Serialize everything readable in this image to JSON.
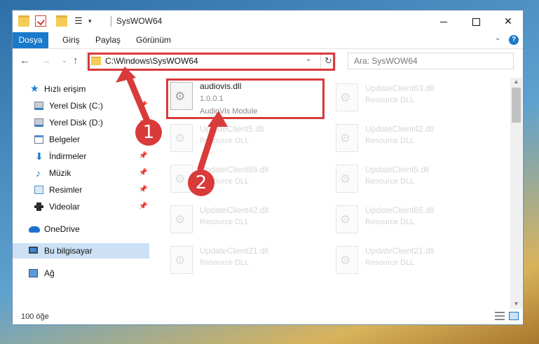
{
  "window": {
    "title": "SysWOW64"
  },
  "ribbon": {
    "tabs": [
      "Dosya",
      "Giriş",
      "Paylaş",
      "Görünüm"
    ],
    "help": "?"
  },
  "navigation": {
    "back": "←",
    "forward": "→",
    "up": "↑"
  },
  "address": {
    "path": "C:\\Windows\\SysWOW64"
  },
  "search": {
    "placeholder": "Ara: SysWOW64"
  },
  "sidebar": {
    "items": [
      {
        "label": "Hızlı erişim"
      },
      {
        "label": "Yerel Disk (C:)"
      },
      {
        "label": "Yerel Disk (D:)"
      },
      {
        "label": "Belgeler"
      },
      {
        "label": "İndirmeler"
      },
      {
        "label": "Müzik"
      },
      {
        "label": "Resimler"
      },
      {
        "label": "Videolar"
      },
      {
        "label": "OneDrive"
      },
      {
        "label": "Bu bilgisayar"
      },
      {
        "label": "Ağ"
      }
    ]
  },
  "files": {
    "highlighted": {
      "name": "audiovis.dll",
      "version": "1.0.0.1",
      "description": "AudioVis Module"
    },
    "col1": [
      {
        "name": "UpdateClient5.dll",
        "type": "Resource DLL"
      },
      {
        "name": "UpdateClient65.dll",
        "type": "Resource DLL"
      },
      {
        "name": "UpdateClient42.dll",
        "type": "Resource DLL"
      },
      {
        "name": "UpdateClient21.dll",
        "type": "Resource DLL"
      }
    ],
    "col2": [
      {
        "name": "UpdateClient63.dll",
        "type": "Resource DLL"
      },
      {
        "name": "UpdateClient42.dll",
        "type": "Resource DLL"
      },
      {
        "name": "UpdateClient5.dll",
        "type": "Resource DLL"
      },
      {
        "name": "UpdateClient65.dll",
        "type": "Resource DLL"
      },
      {
        "name": "UpdateClient21.dll",
        "type": "Resource DLL"
      }
    ]
  },
  "status": {
    "count": "100 öğe"
  },
  "callouts": {
    "one": "1",
    "two": "2"
  },
  "colors": {
    "accent": "#1979ca",
    "highlight": "#d93a3a"
  }
}
